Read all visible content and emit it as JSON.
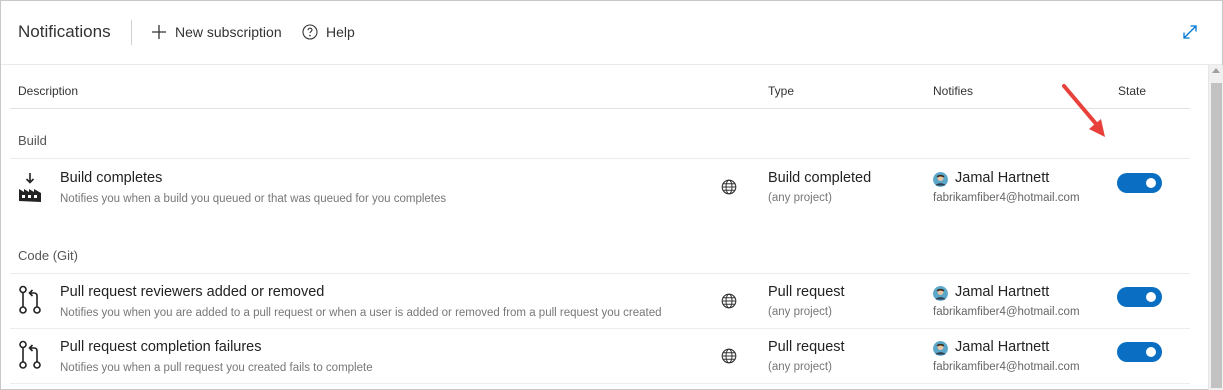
{
  "header": {
    "title": "Notifications",
    "new_subscription_label": "New subscription",
    "help_label": "Help"
  },
  "table": {
    "columns": [
      "Description",
      "Type",
      "Notifies",
      "State"
    ]
  },
  "groups": [
    {
      "name": "Build",
      "rows": [
        {
          "icon": "build-icon",
          "title": "Build completes",
          "description": "Notifies you when a build you queued or that was queued for you completes",
          "type": "Build completed",
          "type_scope": "(any project)",
          "user": "Jamal Hartnett",
          "email": "fabrikamfiber4@hotmail.com",
          "state_on": true
        }
      ]
    },
    {
      "name": "Code (Git)",
      "rows": [
        {
          "icon": "pull-request-icon",
          "title": "Pull request reviewers added or removed",
          "description": "Notifies you when you are added to a pull request or when a user is added or removed from a pull request you created",
          "type": "Pull request",
          "type_scope": "(any project)",
          "user": "Jamal Hartnett",
          "email": "fabrikamfiber4@hotmail.com",
          "state_on": true
        },
        {
          "icon": "pull-request-icon",
          "title": "Pull request completion failures",
          "description": "Notifies you when a pull request you created fails to complete",
          "type": "Pull request",
          "type_scope": "(any project)",
          "user": "Jamal Hartnett",
          "email": "fabrikamfiber4@hotmail.com",
          "state_on": true
        }
      ]
    }
  ],
  "colors": {
    "toggle_on": "#0a6fc2",
    "annotation_arrow": "#e8413c",
    "accent": "#0078d4"
  }
}
